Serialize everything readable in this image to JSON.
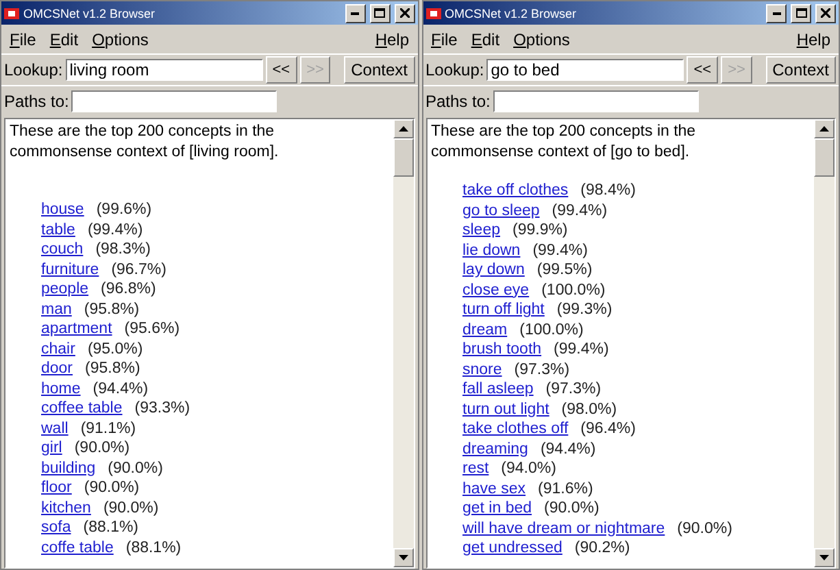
{
  "windows": [
    {
      "title": "OMCSNet v1.2 Browser",
      "menu": [
        "File",
        "Edit",
        "Options"
      ],
      "help": "Help",
      "lookup_label": "Lookup:",
      "lookup_value": "living room",
      "back_button": {
        "label": "<<",
        "disabled": false
      },
      "forward_button": {
        "label": ">>",
        "disabled": true
      },
      "context_button": "Context",
      "paths_label": "Paths to:",
      "intro": "These are the top 200 concepts in the commonsense context of [living room].",
      "spacer": true,
      "concepts": [
        {
          "name": "house",
          "score": "(99.6%)"
        },
        {
          "name": "table",
          "score": "(99.4%)"
        },
        {
          "name": "couch",
          "score": "(98.3%)"
        },
        {
          "name": "furniture",
          "score": "(96.7%)"
        },
        {
          "name": "people",
          "score": "(96.8%)"
        },
        {
          "name": "man",
          "score": "(95.8%)"
        },
        {
          "name": "apartment",
          "score": "(95.6%)"
        },
        {
          "name": "chair",
          "score": "(95.0%)"
        },
        {
          "name": "door",
          "score": "(95.8%)"
        },
        {
          "name": "home",
          "score": "(94.4%)"
        },
        {
          "name": "coffee table",
          "score": "(93.3%)"
        },
        {
          "name": "wall",
          "score": "(91.1%)"
        },
        {
          "name": "girl",
          "score": "(90.0%)"
        },
        {
          "name": "building",
          "score": "(90.0%)"
        },
        {
          "name": "floor",
          "score": "(90.0%)"
        },
        {
          "name": "kitchen",
          "score": "(90.0%)"
        },
        {
          "name": "sofa",
          "score": "(88.1%)"
        },
        {
          "name": "coffe table",
          "score": "(88.1%)"
        }
      ]
    },
    {
      "title": "OMCSNet v1.2 Browser",
      "menu": [
        "File",
        "Edit",
        "Options"
      ],
      "help": "Help",
      "lookup_label": "Lookup:",
      "lookup_value": "go to bed",
      "back_button": {
        "label": "<<",
        "disabled": false
      },
      "forward_button": {
        "label": ">>",
        "disabled": true
      },
      "context_button": "Context",
      "paths_label": "Paths to:",
      "intro": "These are the top 200 concepts in the commonsense context of [go to bed].",
      "spacer": false,
      "concepts": [
        {
          "name": "take off clothes",
          "score": "(98.4%)"
        },
        {
          "name": "go to sleep",
          "score": "(99.4%)"
        },
        {
          "name": "sleep",
          "score": "(99.9%)"
        },
        {
          "name": "lie down",
          "score": "(99.4%)"
        },
        {
          "name": "lay down",
          "score": "(99.5%)"
        },
        {
          "name": "close eye",
          "score": "(100.0%)"
        },
        {
          "name": "turn off light",
          "score": "(99.3%)"
        },
        {
          "name": "dream",
          "score": "(100.0%)"
        },
        {
          "name": "brush tooth",
          "score": "(99.4%)"
        },
        {
          "name": "snore",
          "score": "(97.3%)"
        },
        {
          "name": "fall asleep",
          "score": "(97.3%)"
        },
        {
          "name": "turn out light",
          "score": "(98.0%)"
        },
        {
          "name": "take clothes off",
          "score": "(96.4%)"
        },
        {
          "name": "dreaming",
          "score": "(94.4%)"
        },
        {
          "name": "rest",
          "score": "(94.0%)"
        },
        {
          "name": "have sex",
          "score": "(91.6%)"
        },
        {
          "name": "get in bed",
          "score": "(90.0%)"
        },
        {
          "name": "will have dream or nightmare",
          "score": "(90.0%)"
        },
        {
          "name": "get undressed",
          "score": "(90.2%)"
        }
      ]
    }
  ]
}
